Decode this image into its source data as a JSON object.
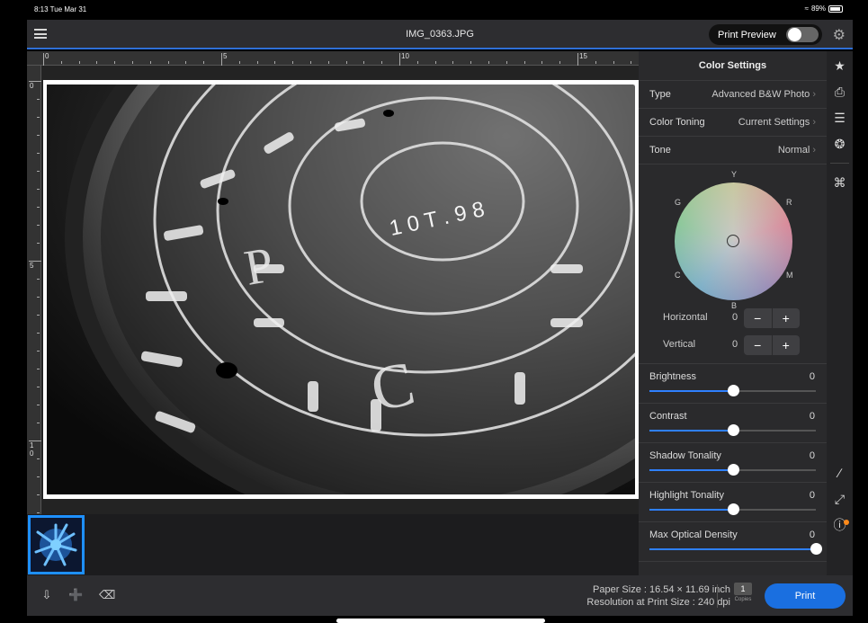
{
  "status": {
    "time": "8:13  Tue Mar 31",
    "battery": "89%",
    "battery_level": 0.89
  },
  "header": {
    "title": "IMG_0363.JPG",
    "print_preview_label": "Print Preview",
    "print_preview_on": false,
    "menu_icon": "hamburger-icon",
    "settings_icon": "gear-icon"
  },
  "ruler": {
    "top_labels": [
      "0",
      "5",
      "10",
      "15"
    ],
    "left_labels": [
      "0",
      "5",
      "1\n0"
    ]
  },
  "color_settings": {
    "title": "Color Settings",
    "type": {
      "label": "Type",
      "value": "Advanced B&W Photo"
    },
    "toning": {
      "label": "Color Toning",
      "value": "Current Settings"
    },
    "tone": {
      "label": "Tone",
      "value": "Normal"
    },
    "wheel_labels": {
      "top": "Y",
      "right_top": "R",
      "right_bottom": "M",
      "bottom": "B",
      "left_bottom": "C",
      "left_top": "G"
    },
    "horizontal": {
      "label": "Horizontal",
      "value": "0"
    },
    "vertical": {
      "label": "Vertical",
      "value": "0"
    },
    "stepper": {
      "minus": "−",
      "plus": "+"
    },
    "sliders": [
      {
        "label": "Brightness",
        "value": "0",
        "level": 0.5
      },
      {
        "label": "Contrast",
        "value": "0",
        "level": 0.5
      },
      {
        "label": "Shadow Tonality",
        "value": "0",
        "level": 0.5
      },
      {
        "label": "Highlight Tonality",
        "value": "0",
        "level": 0.5
      },
      {
        "label": "Max Optical Density",
        "value": "0",
        "level": 1.0
      }
    ]
  },
  "toolbar": {
    "icons": [
      "star-icon",
      "printer-icon",
      "list-icon",
      "color-palette-icon",
      "crop-icon",
      "ruler-icon",
      "fullscreen-icon",
      "info-icon"
    ],
    "glyphs": [
      "★",
      "⎙",
      "☰",
      "❂",
      "⌘",
      "∕",
      "⤢",
      "ⓘ"
    ]
  },
  "bottom": {
    "paper_size": "Paper Size : 16.54 × 11.69 inch",
    "resolution": "Resolution at Print Size : 240 dpi",
    "copies_value": "1",
    "copies_label": "Copies",
    "print_label": "Print",
    "icons": [
      "import-icon",
      "add-photo-icon",
      "trash-icon"
    ],
    "glyphs": [
      "⇩",
      "➕",
      "⌫"
    ]
  },
  "colors": {
    "accent": "#1a6fe0",
    "slider_fill": "#2f80ff",
    "thumb_border": "#1e90ff",
    "badge": "#ff8a1a"
  }
}
